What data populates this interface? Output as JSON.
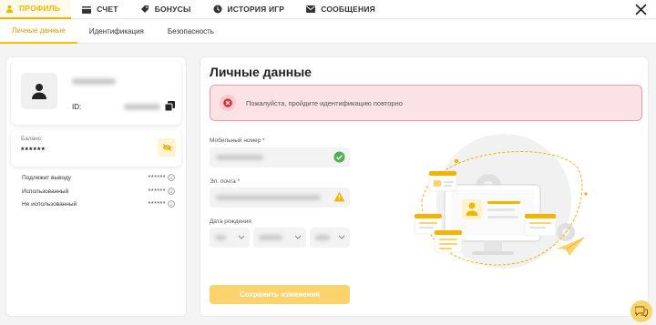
{
  "nav": {
    "tabs": [
      {
        "label": "ПРОФИЛЬ",
        "icon": "user-icon",
        "active": true
      },
      {
        "label": "СЧЕТ",
        "icon": "wallet-icon"
      },
      {
        "label": "БОНУСЫ",
        "icon": "tag-icon"
      },
      {
        "label": "ИСТОРИЯ ИГР",
        "icon": "history-icon"
      },
      {
        "label": "СООБЩЕНИЯ",
        "icon": "mail-icon"
      }
    ]
  },
  "subnav": {
    "tabs": [
      {
        "label": "Личные данные",
        "active": true
      },
      {
        "label": "Идентификация"
      },
      {
        "label": "Безопасность"
      }
    ]
  },
  "profile": {
    "id_label": "ID:"
  },
  "balance": {
    "label": "Баланс",
    "value": "******"
  },
  "stats": [
    {
      "label": "Подлежит выводу",
      "value": "******"
    },
    {
      "label": "Использованный",
      "value": "******"
    },
    {
      "label": "Не использованный",
      "value": "******"
    }
  ],
  "main": {
    "title": "Личные данные",
    "alert_text": "Пожалуйста, пройдите идентификацию повторно",
    "phone_label": "Мобильный номер *",
    "email_label": "Эл. почта *",
    "dob_label": "Дата рождения",
    "save_label": "Сохранить изменения"
  },
  "colors": {
    "accent": "#f3b400",
    "button": "#fbd36c",
    "alert_bg": "#fbe3e5",
    "alert_border": "#ee9aa3",
    "success": "#4caf50",
    "warning": "#f3b400"
  }
}
